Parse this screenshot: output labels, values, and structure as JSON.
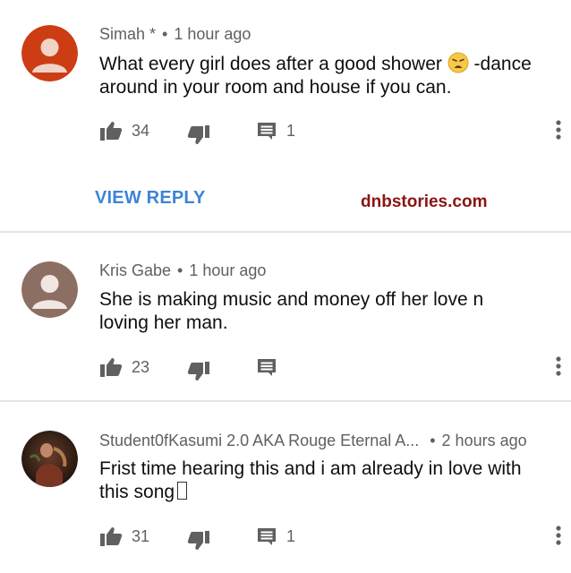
{
  "comments": [
    {
      "author": "Simah *",
      "separator": "•",
      "time": "1 hour ago",
      "text_before_emoji": "What every girl does after a good shower ",
      "emoji_icon": "weary-face-emoji",
      "text_after_emoji": " -dance around in your room and house if you can.",
      "likes": "34",
      "replies": "1",
      "avatar_color": "#cc3d14"
    },
    {
      "author": "Kris Gabe",
      "separator": "•",
      "time": "1 hour ago",
      "text": "She is making music and money off her love n loving her man.",
      "likes": "23",
      "replies": "",
      "avatar_color": "#8d6e63"
    },
    {
      "author": "Student0fKasumi 2.0 AKA Rouge Eternal A...",
      "separator": "•",
      "time": "2 hours ago",
      "text": "Frist time hearing this and i am already in love with this song",
      "likes": "31",
      "replies": "1",
      "avatar_icon": "photo-avatar"
    }
  ],
  "view_reply_label": "VIEW REPLY",
  "watermark": "dnbstories.com",
  "colors": {
    "link_blue": "#3e84d6",
    "watermark_red": "#8a1414",
    "meta_gray": "#606060",
    "icon_gray": "#606060"
  }
}
